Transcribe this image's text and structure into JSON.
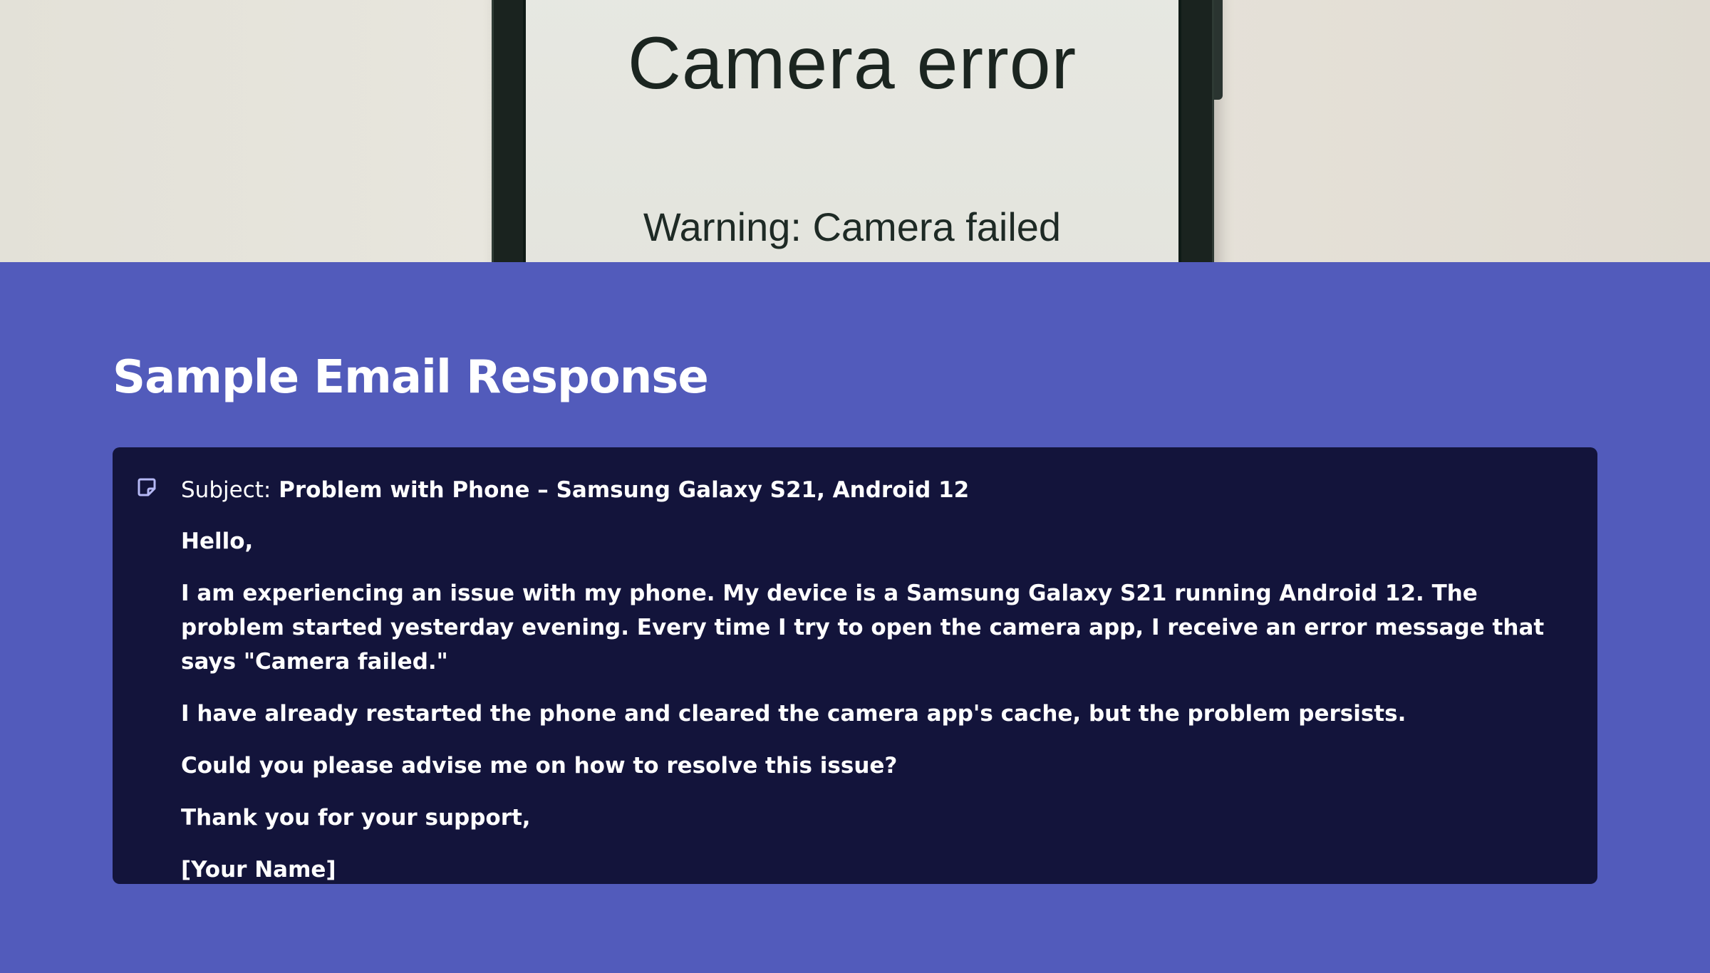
{
  "hero": {
    "screen_title": "Camera error",
    "screen_warning": "Warning: Camera failed"
  },
  "section": {
    "title": "Sample Email Response"
  },
  "email": {
    "icon": "note-icon",
    "subject_prefix": "Subject:",
    "subject_value": "Problem with Phone – Samsung Galaxy S21, Android 12",
    "greeting": "Hello,",
    "paragraph_1": "I am experiencing an issue with my phone. My device is a Samsung Galaxy S21 running Android 12. The problem started yesterday evening. Every time I try to open the camera app, I receive an error message that says \"Camera failed.\"",
    "paragraph_2": "I have already restarted the phone and cleared the camera app's cache, but the problem persists.",
    "paragraph_3": "Could you please advise me on how to resolve this issue?",
    "closing": "Thank you for your support,",
    "signature": "[Your Name]"
  },
  "colors": {
    "background": "#525bbb",
    "card": "#13143b",
    "icon": "#b6b9f5",
    "text": "#ffffff"
  }
}
